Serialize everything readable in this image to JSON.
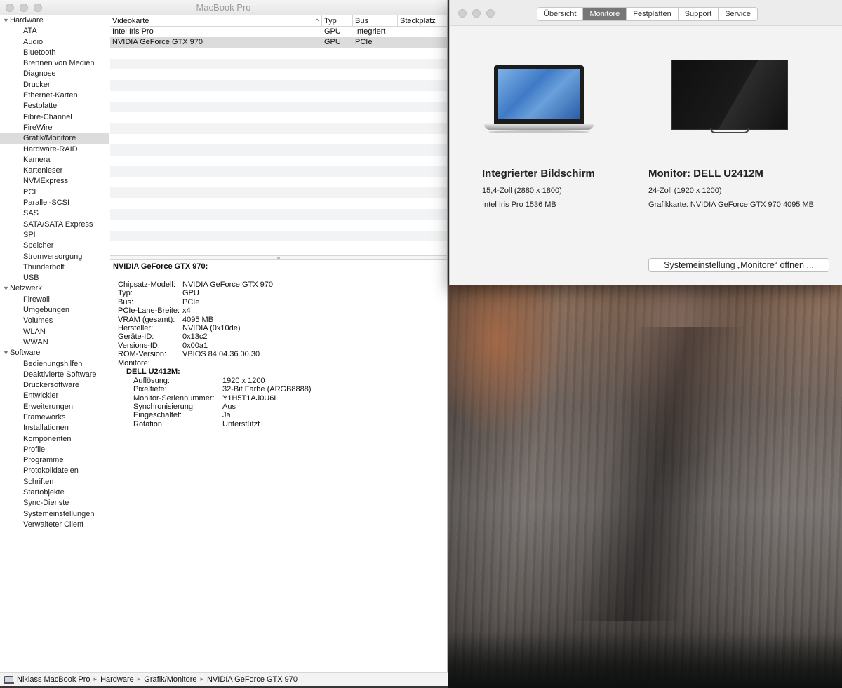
{
  "sysinfo": {
    "window_title": "MacBook Pro",
    "sidebar": {
      "groups": [
        {
          "label": "Hardware",
          "items": [
            "ATA",
            "Audio",
            "Bluetooth",
            "Brennen von Medien",
            "Diagnose",
            "Drucker",
            "Ethernet-Karten",
            "Festplatte",
            "Fibre-Channel",
            "FireWire",
            "Grafik/Monitore",
            "Hardware-RAID",
            "Kamera",
            "Kartenleser",
            "NVMExpress",
            "PCI",
            "Parallel-SCSI",
            "SAS",
            "SATA/SATA Express",
            "SPI",
            "Speicher",
            "Stromversorgung",
            "Thunderbolt",
            "USB"
          ]
        },
        {
          "label": "Netzwerk",
          "items": [
            "Firewall",
            "Umgebungen",
            "Volumes",
            "WLAN",
            "WWAN"
          ]
        },
        {
          "label": "Software",
          "items": [
            "Bedienungshilfen",
            "Deaktivierte Software",
            "Druckersoftware",
            "Entwickler",
            "Erweiterungen",
            "Frameworks",
            "Installationen",
            "Komponenten",
            "Profile",
            "Programme",
            "Protokolldateien",
            "Schriften",
            "Startobjekte",
            "Sync-Dienste",
            "Systemeinstellungen",
            "Verwalteter Client"
          ]
        }
      ],
      "selected": "Grafik/Monitore"
    },
    "table": {
      "headers": [
        "Videokarte",
        "Typ",
        "Bus",
        "Steckplatz"
      ],
      "rows": [
        [
          "Intel Iris Pro",
          "GPU",
          "Integriert",
          ""
        ],
        [
          "NVIDIA GeForce GTX 970",
          "GPU",
          "PCIe",
          ""
        ]
      ]
    },
    "detail": {
      "title": "NVIDIA GeForce GTX 970:",
      "fields": [
        {
          "k": "Chipsatz-Modell:",
          "v": "NVIDIA GeForce GTX 970"
        },
        {
          "k": "Typ:",
          "v": "GPU"
        },
        {
          "k": "Bus:",
          "v": "PCIe"
        },
        {
          "k": "PCIe-Lane-Breite:",
          "v": "x4"
        },
        {
          "k": "VRAM (gesamt):",
          "v": "4095 MB"
        },
        {
          "k": "Hersteller:",
          "v": "NVIDIA (0x10de)"
        },
        {
          "k": "Geräte-ID:",
          "v": "0x13c2"
        },
        {
          "k": "Versions-ID:",
          "v": "0x00a1"
        },
        {
          "k": "ROM-Version:",
          "v": "VBIOS 84.04.36.00.30"
        },
        {
          "k": "Monitore:",
          "v": ""
        }
      ],
      "monitor_name": "DELL U2412M:",
      "monitor_fields": [
        {
          "k": "Auflösung:",
          "v": "1920 x 1200"
        },
        {
          "k": "Pixeltiefe:",
          "v": "32-Bit Farbe (ARGB8888)"
        },
        {
          "k": "Monitor-Seriennummer:",
          "v": "Y1H5T1AJ0U6L"
        },
        {
          "k": "Synchronisierung:",
          "v": "Aus"
        },
        {
          "k": "Eingeschaltet:",
          "v": "Ja"
        },
        {
          "k": "Rotation:",
          "v": "Unterstützt"
        }
      ]
    },
    "pathbar": [
      "Niklass MacBook Pro",
      "Hardware",
      "Grafik/Monitore",
      "NVIDIA GeForce GTX 970"
    ]
  },
  "about": {
    "tabs": [
      "Übersicht",
      "Monitore",
      "Festplatten",
      "Support",
      "Service"
    ],
    "active_tab": "Monitore",
    "displays": [
      {
        "name": "Integrierter Bildschirm",
        "line1": "15,4-Zoll (2880 x 1800)",
        "line2": "Intel Iris Pro 1536 MB"
      },
      {
        "name": "Monitor: DELL U2412M",
        "line1": "24-Zoll (1920 x 1200)",
        "line2": "Grafikkarte: NVIDIA GeForce GTX 970 4095 MB"
      }
    ],
    "open_button": "Systemeinstellung „Monitore“ öffnen ..."
  }
}
